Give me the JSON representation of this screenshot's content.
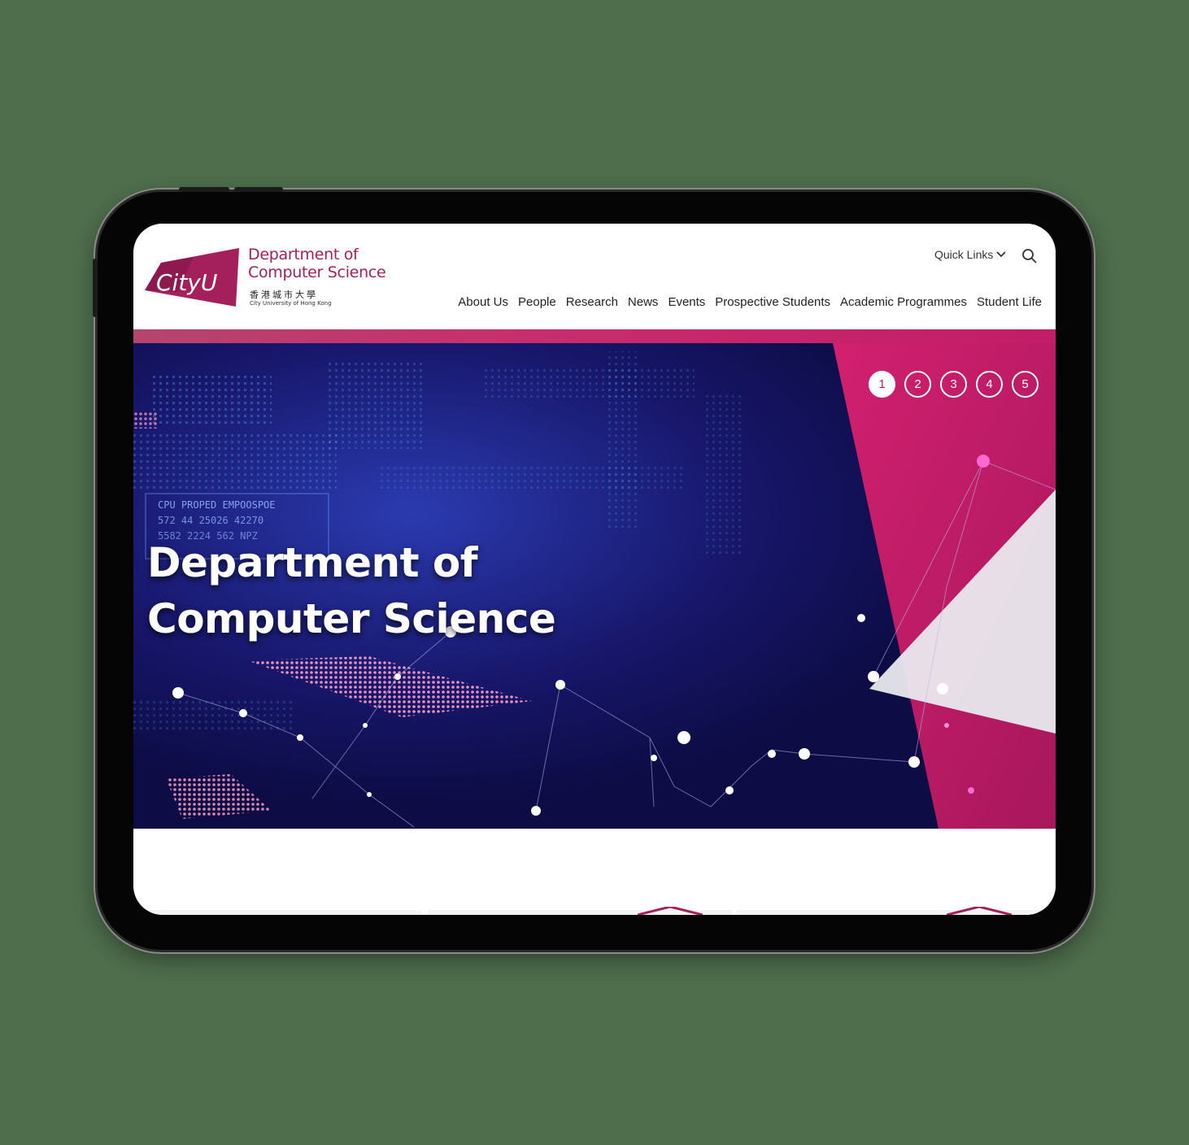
{
  "brand": {
    "logo_text": "CityU",
    "dept_line1": "Department of",
    "dept_line2": "Computer Science",
    "chinese_name": "香港城市大學",
    "english_name": "City University of Hong Kong",
    "colors": {
      "primary": "#a3205c",
      "accent": "#c31c68",
      "hero_bg": "#14125a"
    }
  },
  "header": {
    "quick_links_label": "Quick Links",
    "quick_links_icon": "chevron-down-icon",
    "search_icon": "search-icon"
  },
  "nav": {
    "items": [
      {
        "label": "About Us"
      },
      {
        "label": "People"
      },
      {
        "label": "Research"
      },
      {
        "label": "News"
      },
      {
        "label": "Events"
      },
      {
        "label": "Prospective Students"
      },
      {
        "label": "Academic Programmes"
      },
      {
        "label": "Student Life"
      }
    ]
  },
  "hero": {
    "title_line1": "Department of",
    "title_line2": "Computer Science",
    "slides": [
      "1",
      "2",
      "3",
      "4",
      "5"
    ],
    "active_slide": "1"
  }
}
